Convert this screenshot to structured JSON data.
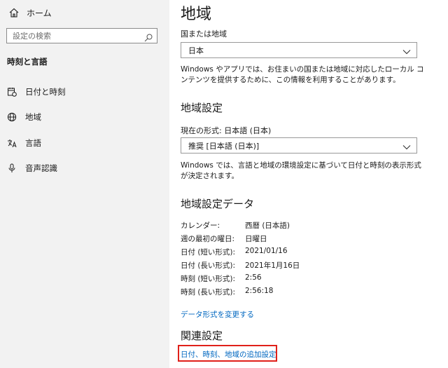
{
  "sidebar": {
    "home_label": "ホーム",
    "search_placeholder": "設定の検索",
    "section_title": "時刻と言語",
    "items": [
      {
        "label": "日付と時刻",
        "icon": "calendar-clock-icon"
      },
      {
        "label": "地域",
        "icon": "globe-icon"
      },
      {
        "label": "言語",
        "icon": "language-icon"
      },
      {
        "label": "音声認識",
        "icon": "microphone-icon"
      }
    ]
  },
  "main": {
    "title": "地域",
    "country_label": "国または地域",
    "country_value": "日本",
    "country_desc": "Windows やアプリでは、お住まいの国または地域に対応したローカル コンテンツを提供するために、この情報を利用することがあります。",
    "regional_heading": "地域設定",
    "current_format_label": "現在の形式: 日本語 (日本)",
    "format_value": "推奨 [日本語 (日本)]",
    "format_desc": "Windows では、言語と地域の環境設定に基づいて日付と時刻の表示形式が決定されます。",
    "data_heading": "地域設定データ",
    "data_rows": [
      {
        "key": "カレンダー:",
        "value": "西暦 (日本語)"
      },
      {
        "key": "週の最初の曜日:",
        "value": "日曜日"
      },
      {
        "key": "日付 (短い形式):",
        "value": "2021/01/16"
      },
      {
        "key": "日付 (長い形式):",
        "value": "2021年1月16日"
      },
      {
        "key": "時刻 (短い形式):",
        "value": "2:56"
      },
      {
        "key": "時刻 (長い形式):",
        "value": "2:56:18"
      }
    ],
    "change_format_link": "データ形式を変更する",
    "related_heading": "関連設定",
    "related_link": "日付、時刻、地域の追加設定"
  },
  "colors": {
    "sidebar_bg": "#f2f2f2",
    "link": "#0067c0",
    "highlight": "#e0201a"
  }
}
